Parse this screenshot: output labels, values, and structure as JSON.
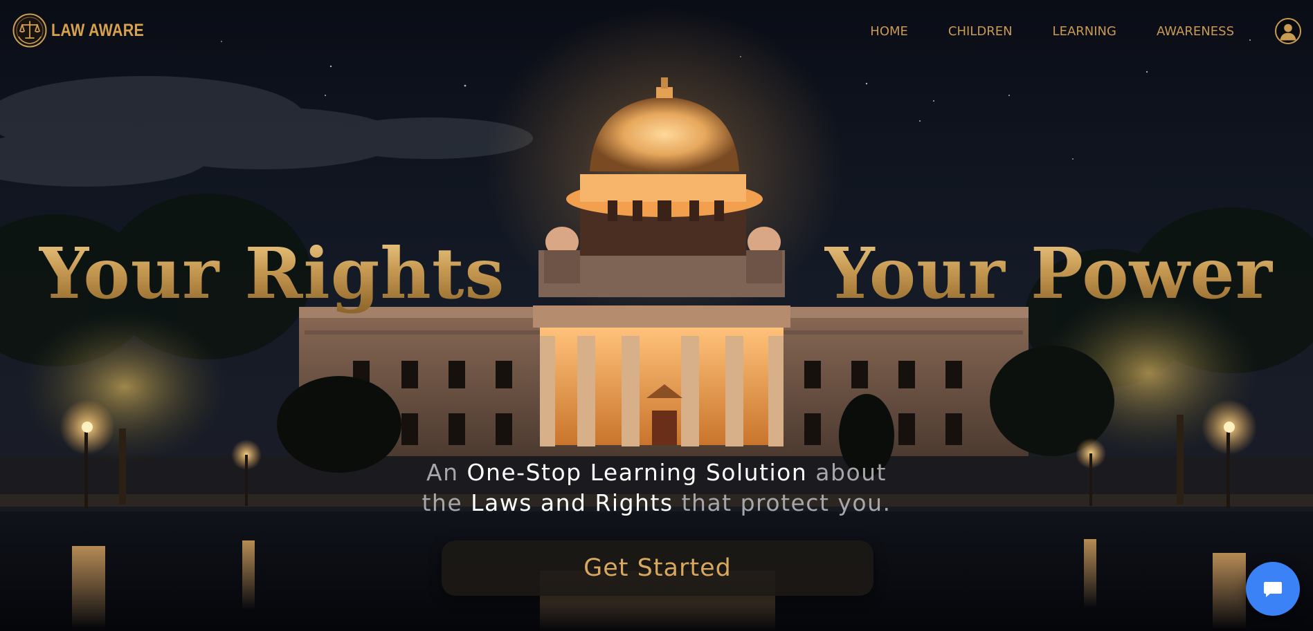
{
  "brand": {
    "name": "LAW AWARE",
    "emblem_icon": "scales-of-justice-icon"
  },
  "nav": {
    "items": [
      {
        "label": "HOME"
      },
      {
        "label": "CHILDREN"
      },
      {
        "label": "LEARNING"
      },
      {
        "label": "AWARENESS"
      }
    ],
    "profile_icon": "user-profile-icon"
  },
  "hero": {
    "headline_left": "Your Rights",
    "headline_right": "Your Power",
    "tagline": {
      "seg1": "An ",
      "seg2": "One-Stop Learning Solution",
      "seg3": " about",
      "seg4": "the ",
      "seg5": "Laws and Rights",
      "seg6": " that protect you."
    },
    "cta_label": "Get Started",
    "background": "night-view-of-domed-court-building-with-lamps-and-reflecting-water"
  },
  "chat": {
    "icon": "chat-bubble-icon"
  },
  "colors": {
    "gold": "#c99a52",
    "gold_light": "#f0d08a",
    "chat_blue": "#3b82f6",
    "tagline_muted": "#a7a7ab",
    "tagline_highlight": "#ffffff",
    "cta_background": "#1c1916"
  }
}
